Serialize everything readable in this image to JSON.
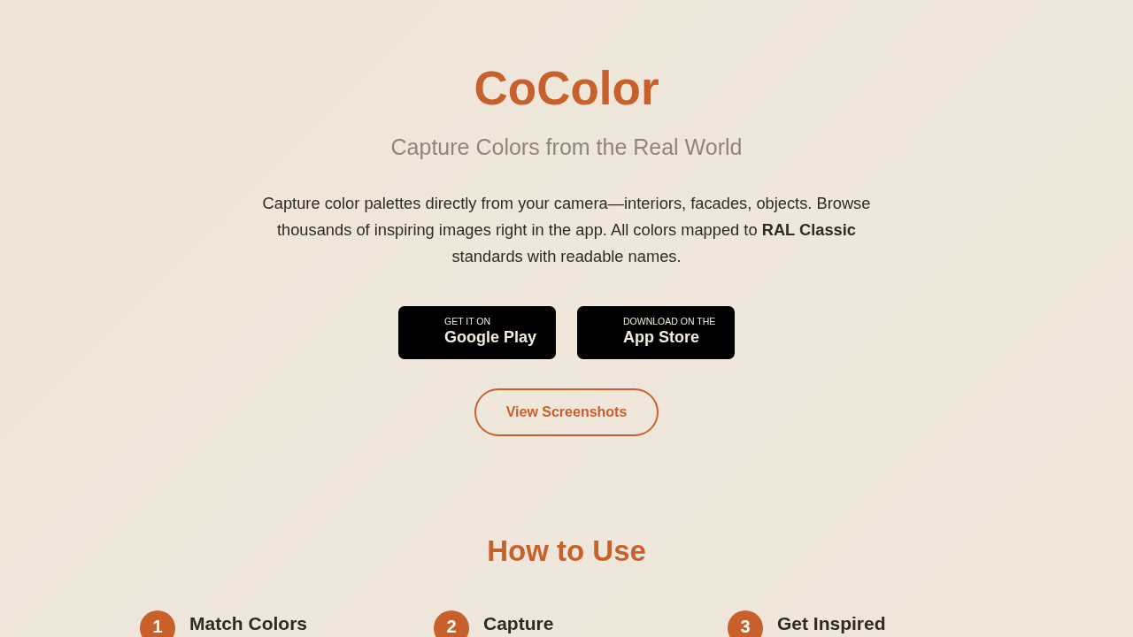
{
  "header": {
    "title": "CoColor",
    "subtitle": "Capture Colors from the Real World",
    "description": "Capture color palettes directly from your camera—interiors, facades, objects. Browse thousands of inspiring images right in the app. All colors mapped to **RAL Classic** standards with readable names."
  },
  "store_buttons": [
    {
      "caption": "GET IT ON",
      "label": "Google Play"
    },
    {
      "caption": "DOWNLOAD ON THE",
      "label": "App Store"
    }
  ],
  "secondary_button": "View Screenshots",
  "how_to_use": {
    "heading": "How to Use",
    "steps": [
      {
        "number": "1",
        "title": "Match Colors"
      },
      {
        "number": "2",
        "title": "Capture"
      },
      {
        "number": "3",
        "title": "Get Inspired"
      }
    ]
  }
}
